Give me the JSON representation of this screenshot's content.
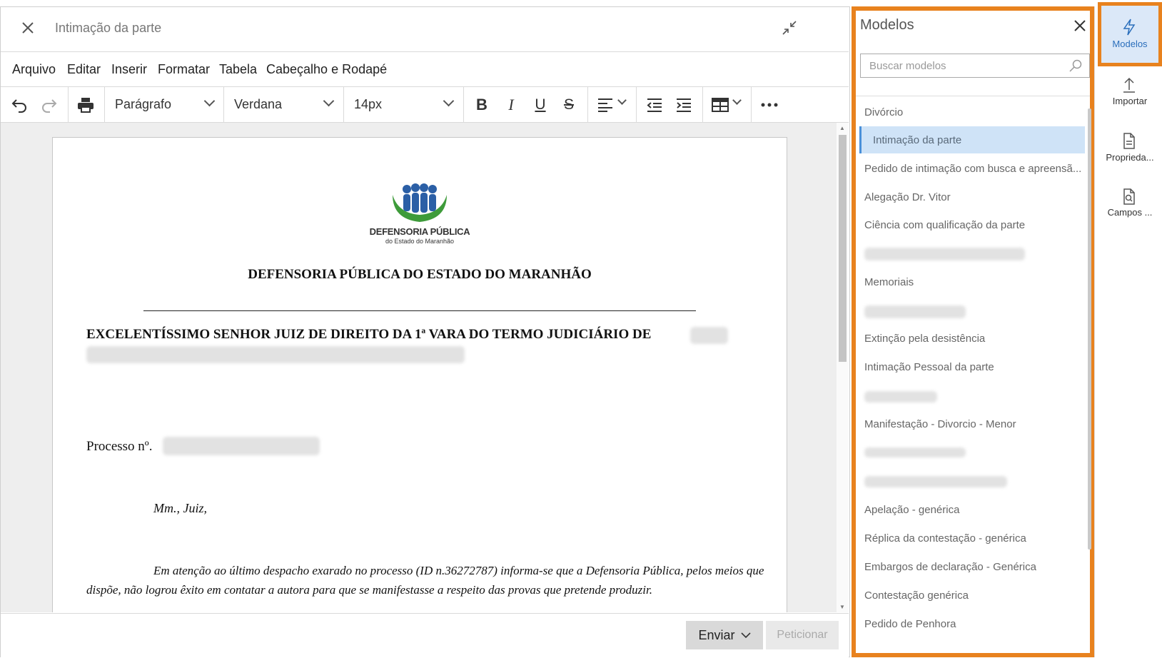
{
  "editor": {
    "title": "Intimação da parte",
    "menu": [
      "Arquivo",
      "Editar",
      "Inserir",
      "Formatar",
      "Tabela",
      "Cabeçalho e Rodapé"
    ],
    "toolbar": {
      "paragraph": "Parágrafo",
      "font": "Verdana",
      "size": "14px"
    },
    "document": {
      "logo_line1": "DEFENSORIA PÚBLICA",
      "logo_line2": "do Estado do Maranhão",
      "heading": "DEFENSORIA PÚBLICA DO ESTADO DO MARANHÃO",
      "address": "EXCELENTÍSSIMO SENHOR JUIZ DE DIREITO DA 1ª VARA DO TERMO JUDICIÁRIO DE",
      "process_label": "Processo nº.",
      "greeting": "Mm., Juiz,",
      "body_line1": "Em atenção ao último despacho exarado no processo (ID n.36272787) informa-se que a Defensoria Pública, pelos meios que",
      "body_line2": "dispõe, não logrou êxito em contatar a autora para que se manifestasse a respeito das provas que pretende produzir."
    },
    "footer": {
      "send": "Enviar",
      "petition": "Peticionar"
    }
  },
  "panel": {
    "title": "Modelos",
    "search_placeholder": "Buscar modelos",
    "items": [
      "Divórcio",
      "Intimação da parte",
      "Pedido de intimação com busca e apreensã...",
      "Alegação Dr. Vitor",
      "Ciência com qualificação da parte",
      "Memoriais",
      "Extinção pela desistência",
      "Intimação Pessoal da parte",
      "Manifestação - Divorcio - Menor",
      "Apelação - genérica",
      "Réplica da contestação - genérica",
      "Embargos de declaração - Genérica",
      "Contestação genérica",
      "Pedido de Penhora"
    ]
  },
  "rail": {
    "models": "Modelos",
    "import": "Importar",
    "properties": "Proprieda...",
    "fields": "Campos ..."
  },
  "colors": {
    "accent": "#e8821e",
    "selected": "#cfe3f7",
    "selected_border": "#4a90d9"
  }
}
